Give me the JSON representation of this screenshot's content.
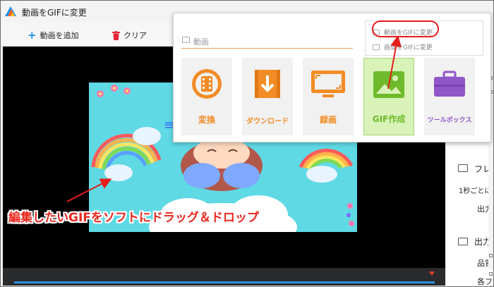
{
  "window": {
    "title": "動画をGIFに変更"
  },
  "toolbar": {
    "add_label": "動画を追加",
    "clear_label": "クリア"
  },
  "popup": {
    "section_label": "動画",
    "cards": [
      {
        "label": "変換",
        "icon": "film-convert-icon",
        "color": "#f28c25"
      },
      {
        "label": "ダウンロード",
        "icon": "download-icon",
        "color": "#f28c25"
      },
      {
        "label": "録画",
        "icon": "monitor-record-icon",
        "color": "#f28c25"
      },
      {
        "label": "GIF作成",
        "icon": "gif-image-icon",
        "color": "#6fba2c"
      },
      {
        "label": "ツールボックス",
        "icon": "toolbox-icon",
        "color": "#9057c9"
      }
    ],
    "submenu": {
      "item1": "動画をGIFに変更",
      "item2": "画像をGIFに変更"
    }
  },
  "right_panel": {
    "frame_label": "フレ",
    "interval_label": "1秒ごとに",
    "output_label": "出力",
    "output_section_label": "出力",
    "quality_label": "品質",
    "each_label": "各フ"
  },
  "annotation": {
    "caption": "編集したいGIFをソフトにドラッグ＆ドロップ",
    "color": "#e8281f"
  }
}
